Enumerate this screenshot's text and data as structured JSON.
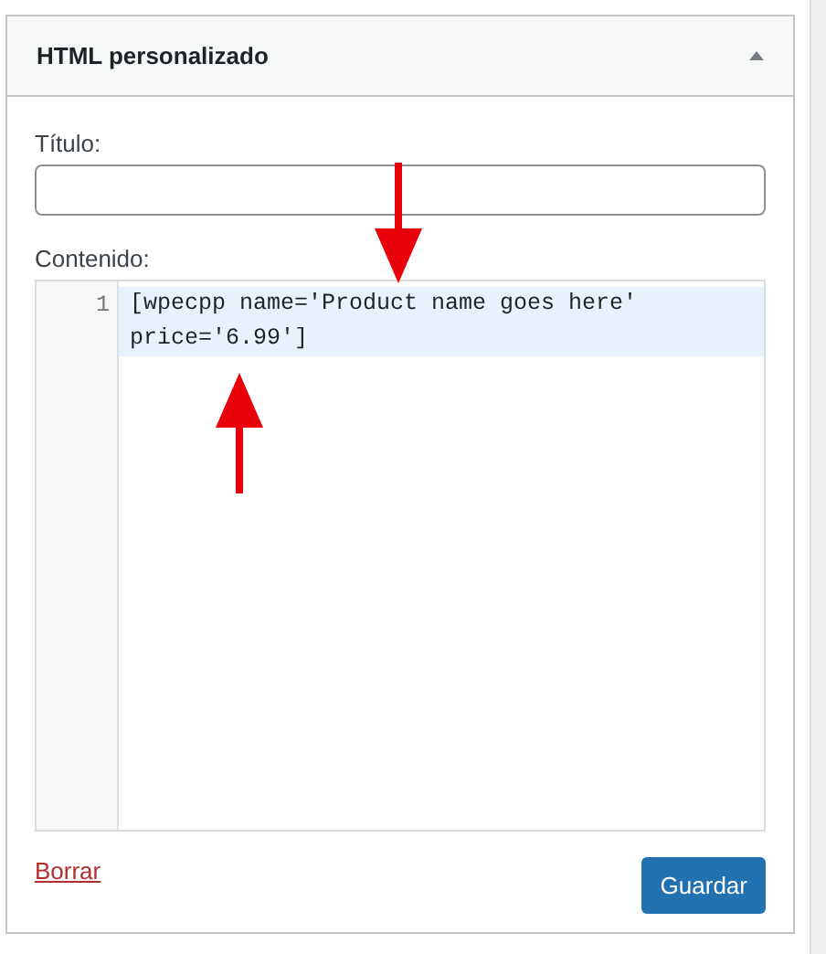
{
  "widget": {
    "title": "HTML personalizado",
    "expanded": true,
    "fields": [
      {
        "label": "Título:",
        "kind": "text"
      },
      {
        "label": "Contenido:",
        "kind": "code",
        "lines": [
          {
            "number": "1",
            "text": "[wpecpp name='Product name goes here' price='6.99']",
            "selected": true
          }
        ]
      }
    ],
    "delete_link": "Borrar",
    "save_button": "Guardar"
  },
  "annotations": [
    {
      "kind": "down"
    },
    {
      "kind": "up"
    }
  ]
}
